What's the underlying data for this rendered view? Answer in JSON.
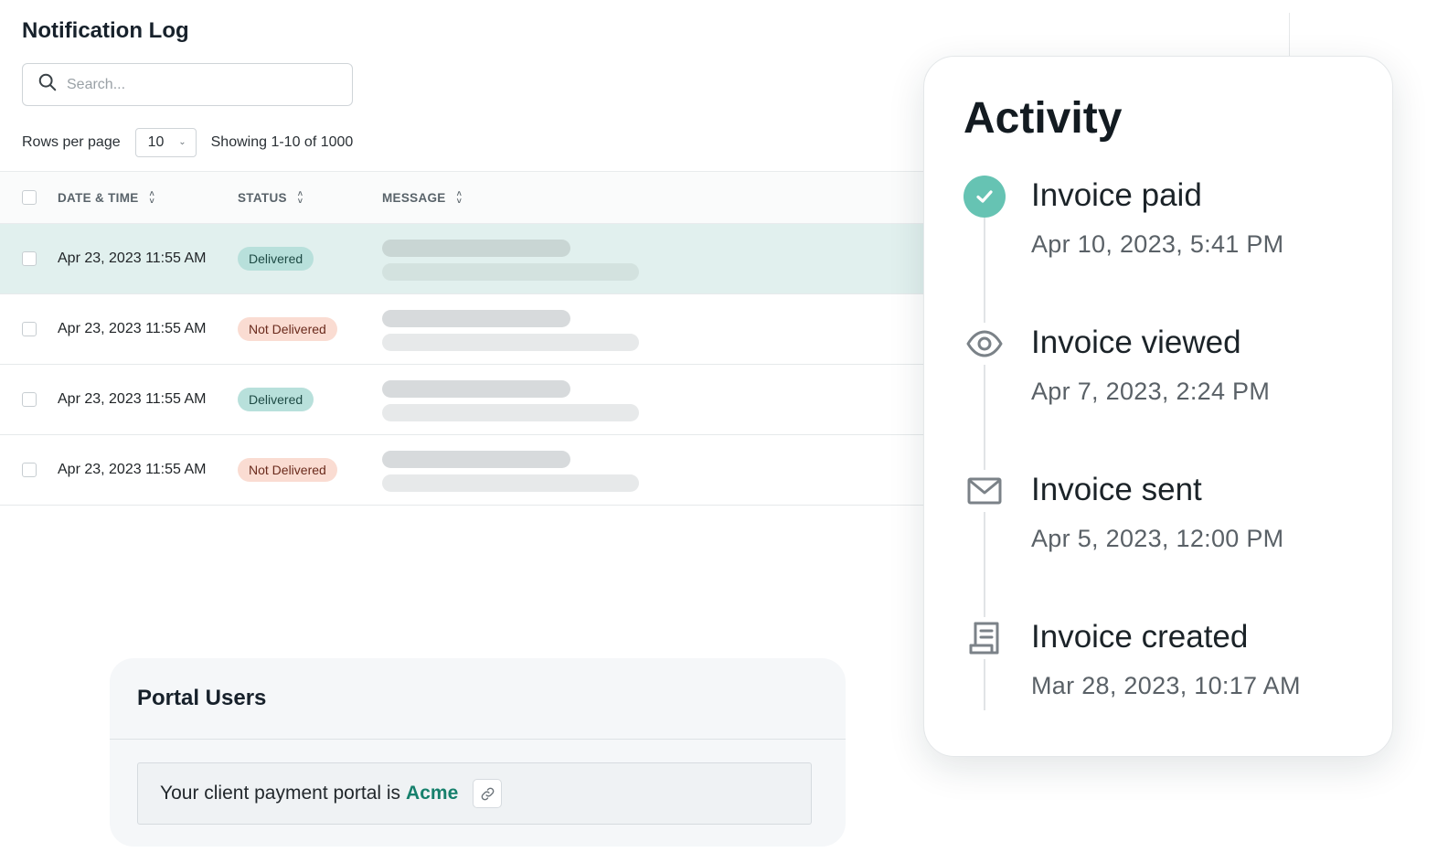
{
  "notification_log": {
    "title": "Notification Log",
    "search": {
      "placeholder": "Search..."
    },
    "pagination": {
      "rows_per_page_label": "Rows per page",
      "rows_per_page_value": "10",
      "showing_text": "Showing 1-10 of 1000"
    },
    "columns": [
      "DATE & TIME",
      "STATUS",
      "MESSAGE"
    ],
    "rows": [
      {
        "datetime": "Apr 23, 2023 11:55 AM",
        "status": "Delivered",
        "status_kind": "delivered",
        "selected": true
      },
      {
        "datetime": "Apr 23, 2023 11:55 AM",
        "status": "Not Delivered",
        "status_kind": "not-delivered",
        "selected": false
      },
      {
        "datetime": "Apr 23, 2023 11:55 AM",
        "status": "Delivered",
        "status_kind": "delivered",
        "selected": false
      },
      {
        "datetime": "Apr 23, 2023 11:55 AM",
        "status": "Not Delivered",
        "status_kind": "not-delivered",
        "selected": false
      }
    ]
  },
  "portal_users": {
    "title": "Portal Users",
    "text": "Your client payment portal is",
    "portal_name": "Acme",
    "link_icon": "link-icon"
  },
  "activity": {
    "title": "Activity",
    "events": [
      {
        "icon": "check-circle-icon",
        "title": "Invoice paid",
        "time": "Apr 10, 2023, 5:41 PM"
      },
      {
        "icon": "eye-icon",
        "title": "Invoice viewed",
        "time": "Apr 7, 2023, 2:24 PM"
      },
      {
        "icon": "envelope-icon",
        "title": "Invoice sent",
        "time": "Apr 5, 2023, 12:00 PM"
      },
      {
        "icon": "document-icon",
        "title": "Invoice created",
        "time": "Mar 28, 2023, 10:17 AM"
      }
    ]
  },
  "colors": {
    "accent_teal": "#66c3b3",
    "selected_row": "#e1f0ee",
    "delivered_badge": "#b8e0db",
    "not_delivered_badge": "#fadcd2",
    "portal_link": "#16806c"
  }
}
